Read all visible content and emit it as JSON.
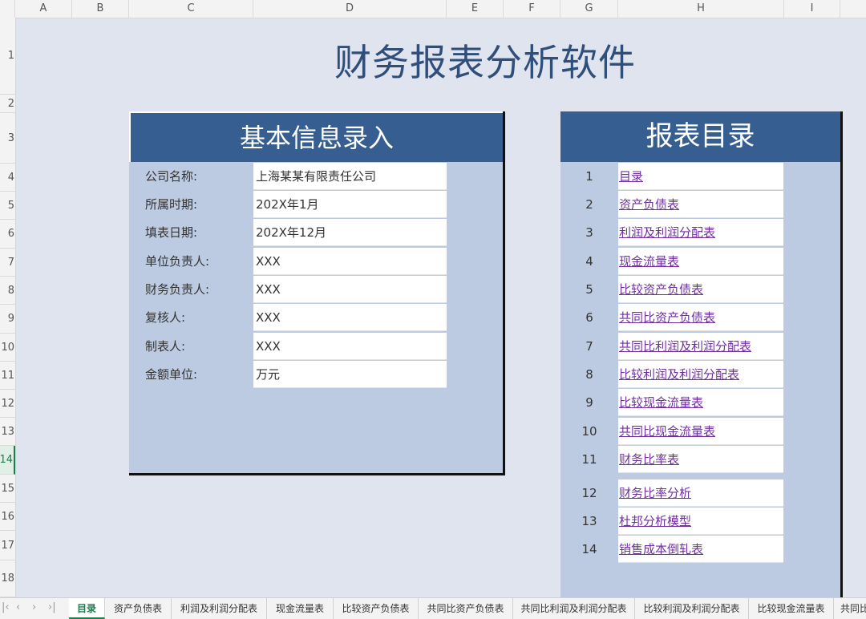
{
  "columns": [
    "A",
    "B",
    "C",
    "D",
    "E",
    "F",
    "G",
    "H",
    "I"
  ],
  "rows": [
    "1",
    "2",
    "3",
    "4",
    "5",
    "6",
    "7",
    "8",
    "9",
    "10",
    "11",
    "12",
    "13",
    "14",
    "15",
    "16",
    "17",
    "18"
  ],
  "selected_row": "14",
  "title": "财务报表分析软件",
  "basic_info": {
    "heading": "基本信息录入",
    "fields": [
      {
        "label": "公司名称:",
        "value": "上海某某有限责任公司"
      },
      {
        "label": "所属时期:",
        "value": "202X年1月"
      },
      {
        "label": "填表日期:",
        "value": "202X年12月"
      },
      {
        "label": "单位负责人:",
        "value": "XXX"
      },
      {
        "label": "财务负责人:",
        "value": "XXX"
      },
      {
        "label": "复核人:",
        "value": "XXX"
      },
      {
        "label": "制表人:",
        "value": "XXX"
      },
      {
        "label": "金额单位:",
        "value": "万元"
      }
    ]
  },
  "toc": {
    "heading": "报表目录",
    "items": [
      {
        "num": "1",
        "label": "目录"
      },
      {
        "num": "2",
        "label": "资产负债表"
      },
      {
        "num": "3",
        "label": "利润及利润分配表"
      },
      {
        "num": "4",
        "label": "现金流量表"
      },
      {
        "num": "5",
        "label": "比较资产负债表"
      },
      {
        "num": "6",
        "label": "共同比资产负债表"
      },
      {
        "num": "7",
        "label": "共同比利润及利润分配表"
      },
      {
        "num": "8",
        "label": "比较利润及利润分配表"
      },
      {
        "num": "9",
        "label": "比较现金流量表"
      },
      {
        "num": "10",
        "label": "共同比现金流量表"
      },
      {
        "num": "11",
        "label": "财务比率表"
      },
      {
        "num": "12",
        "label": "财务比率分析"
      },
      {
        "num": "13",
        "label": "杜邦分析模型"
      },
      {
        "num": "14",
        "label": "销售成本倒轧表"
      }
    ]
  },
  "sheet_tabs": [
    "目录",
    "资产负债表",
    "利润及利润分配表",
    "现金流量表",
    "比较资产负债表",
    "共同比资产负债表",
    "共同比利润及利润分配表",
    "比较利润及利润分配表",
    "比较现金流量表",
    "共同比"
  ],
  "active_tab": "目录",
  "nav_icons": [
    "first-sheet-icon",
    "prev-sheet-icon",
    "next-sheet-icon",
    "last-sheet-icon"
  ]
}
